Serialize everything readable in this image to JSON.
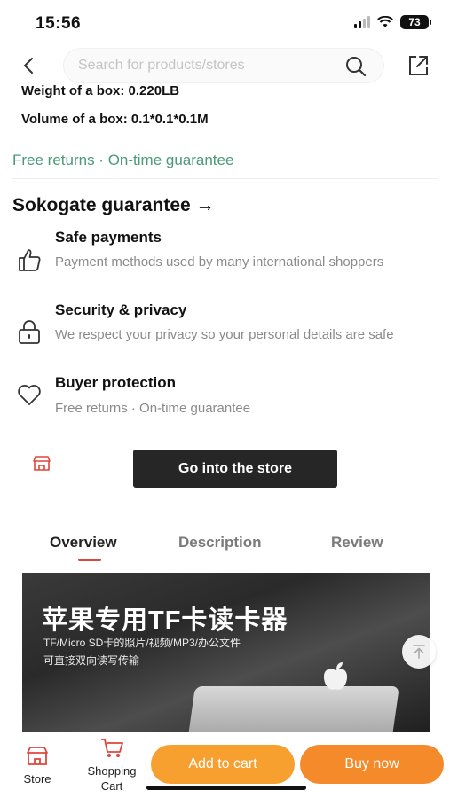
{
  "status_bar": {
    "time": "15:56",
    "battery": "73"
  },
  "search": {
    "placeholder": "Search for products/stores"
  },
  "specs": {
    "weight": "Weight of a box: 0.220LB",
    "volume": "Volume of a box: 0.1*0.1*0.1M"
  },
  "returns_line": "Free returns · On-time guarantee",
  "guarantee": {
    "title": "Sokogate guarantee →",
    "items": [
      {
        "icon": "thumbs-up-icon",
        "title": "Safe payments",
        "desc": "Payment methods used by many international shoppers"
      },
      {
        "icon": "lock-icon",
        "title": "Security & privacy",
        "desc": "We respect your privacy so your personal details are safe"
      },
      {
        "icon": "heart-icon",
        "title": "Buyer protection",
        "desc": "Free returns · On-time guarantee"
      }
    ]
  },
  "store_button": "Go into the store",
  "tabs": [
    {
      "label": "Overview",
      "active": true
    },
    {
      "label": "Description",
      "active": false
    },
    {
      "label": "Review",
      "active": false
    }
  ],
  "banner": {
    "title": "苹果专用TF卡读卡器",
    "sub1": "TF/Micro SD卡的照片/视频/MP3/办公文件",
    "sub2": "可直接双向读写传输"
  },
  "bottom_bar": {
    "store_label": "Store",
    "cart_label_1": "Shopping",
    "cart_label_2": "Cart",
    "add_to_cart": "Add to cart",
    "buy_now": "Buy now"
  },
  "colors": {
    "accent_green": "#4a9a78",
    "tab_underline": "#e0453a",
    "add_to_cart": "#f7a030",
    "buy_now": "#f58a2a",
    "store_button": "#262626"
  }
}
